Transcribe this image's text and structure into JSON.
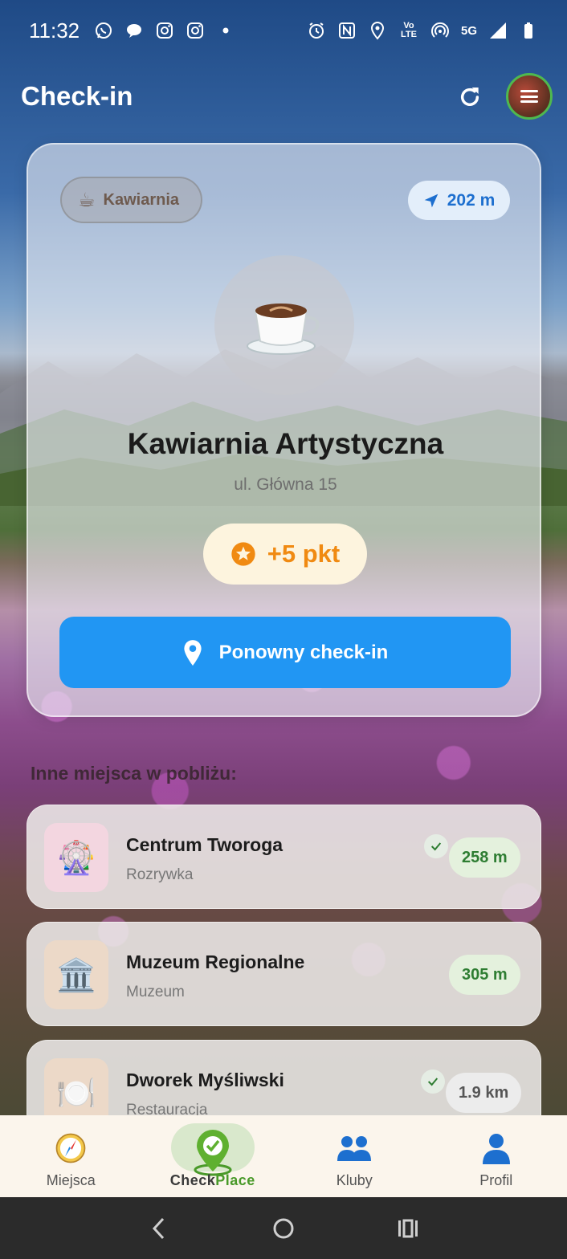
{
  "status_bar": {
    "time": "11:32",
    "network": "5G",
    "icons": [
      "whatsapp-icon",
      "chat-icon",
      "instagram-icon",
      "instagram-icon",
      "dot-icon",
      "alarm-icon",
      "nfc-icon",
      "location-icon",
      "volte-icon",
      "hotspot-icon",
      "signal-icon",
      "battery-icon"
    ],
    "volte_label": "Vo LTE"
  },
  "appbar": {
    "title": "Check-in"
  },
  "current_place": {
    "category": "Kawiarnia",
    "category_emoji": "☕",
    "distance": "202 m",
    "icon_emoji": "☕",
    "name": "Kawiarnia Artystyczna",
    "address": "ul. Główna 15",
    "points": "+5 pkt",
    "checkin_button": "Ponowny check-in"
  },
  "nearby": {
    "section_title": "Inne miejsca w pobliżu:",
    "items": [
      {
        "name": "Centrum Tworoga",
        "category": "Rozrywka",
        "distance": "258 m",
        "emoji": "🎡",
        "checked": true
      },
      {
        "name": "Muzeum Regionalne",
        "category": "Muzeum",
        "distance": "305 m",
        "emoji": "🏛️",
        "checked": false
      },
      {
        "name": "Dworek Myśliwski",
        "category": "Restauracja",
        "distance": "1.9 km",
        "emoji": "🍽️",
        "checked": true
      }
    ]
  },
  "bottom_nav": {
    "items": [
      {
        "label": "Miejsca",
        "icon": "compass-icon"
      },
      {
        "label_check": "Check",
        "label_place": "Place",
        "icon": "checkplace-logo-icon"
      },
      {
        "label": "Kluby",
        "icon": "people-icon"
      },
      {
        "label": "Profil",
        "icon": "person-icon"
      }
    ]
  },
  "colors": {
    "primary": "#2196f3",
    "points": "#f08a12",
    "distance_green": "#2e7d32",
    "nav_bg": "#fbf5ec"
  }
}
